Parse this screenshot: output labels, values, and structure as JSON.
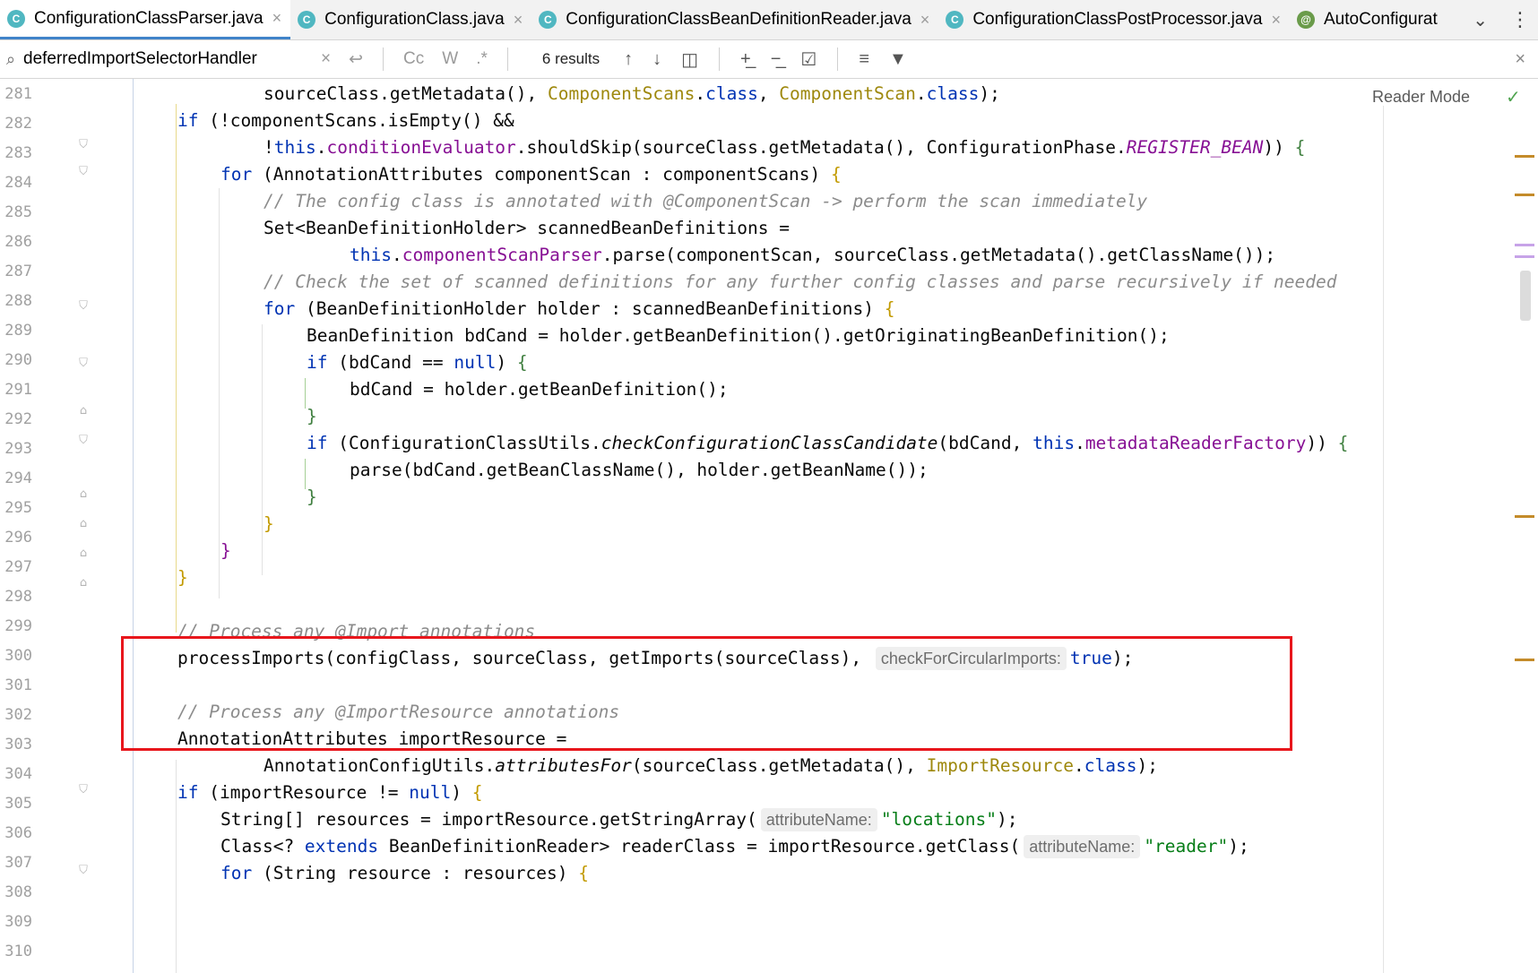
{
  "tabs": [
    {
      "label": "ConfigurationClassParser.java",
      "icon": "class-icon",
      "active": true
    },
    {
      "label": "ConfigurationClass.java",
      "icon": "class-icon"
    },
    {
      "label": "ConfigurationClassBeanDefinitionReader.java",
      "icon": "class-icon"
    },
    {
      "label": "ConfigurationClassPostProcessor.java",
      "icon": "class-icon"
    },
    {
      "label": "AutoConfigurat",
      "icon": "annotation-icon"
    }
  ],
  "search": {
    "query": "deferredImportSelectorHandler",
    "results": "6 results",
    "case_label": "Cc",
    "word_label": "W",
    "regex_label": ".*"
  },
  "editor": {
    "reader_mode": "Reader Mode",
    "line_numbers": [
      "281",
      "282",
      "283",
      "284",
      "285",
      "286",
      "287",
      "288",
      "289",
      "290",
      "291",
      "292",
      "293",
      "294",
      "295",
      "296",
      "297",
      "298",
      "299",
      "300",
      "301",
      "302",
      "303",
      "304",
      "305",
      "306",
      "307",
      "308",
      "309",
      "310"
    ],
    "hints": {
      "check_circular": "checkForCircularImports:",
      "attribute_name": "attributeName:"
    }
  },
  "colors": {
    "highlight_box": "#e8161c",
    "active_tab_underline": "#4083c9",
    "keyword": "#0033b3",
    "field": "#871094",
    "comment": "#8c8c8c",
    "string": "#067d17"
  }
}
